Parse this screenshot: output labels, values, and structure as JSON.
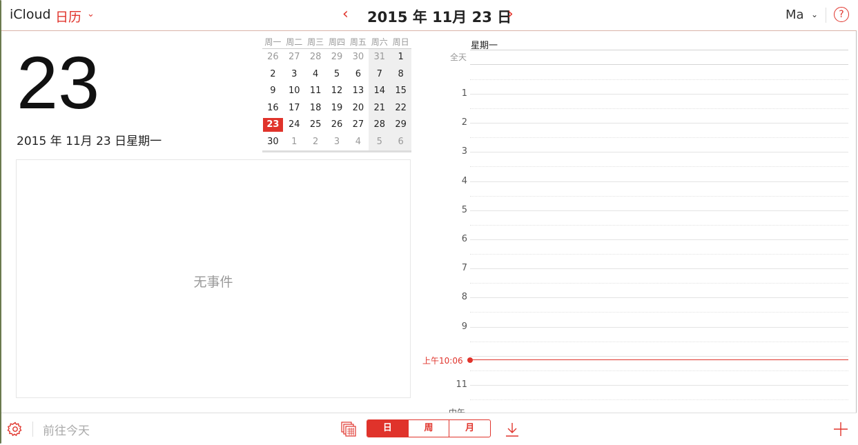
{
  "header": {
    "app_name": "iCloud",
    "app_section": "日历",
    "title": "2015 年 11月 23 日",
    "user": "Ma",
    "help": "?"
  },
  "day_panel": {
    "big_day": "23",
    "full_date": "2015 年 11月 23 日星期一",
    "no_events": "无事件"
  },
  "mini_calendar": {
    "weekdays": [
      "周一",
      "周二",
      "周三",
      "周四",
      "周五",
      "周六",
      "周日"
    ],
    "weeks": [
      [
        "26",
        "27",
        "28",
        "29",
        "30",
        "31",
        "1"
      ],
      [
        "2",
        "3",
        "4",
        "5",
        "6",
        "7",
        "8"
      ],
      [
        "9",
        "10",
        "11",
        "12",
        "13",
        "14",
        "15"
      ],
      [
        "16",
        "17",
        "18",
        "19",
        "20",
        "21",
        "22"
      ],
      [
        "23",
        "24",
        "25",
        "26",
        "27",
        "28",
        "29"
      ],
      [
        "30",
        "1",
        "2",
        "3",
        "4",
        "5",
        "6"
      ]
    ],
    "today": "23"
  },
  "day_view": {
    "weekday": "星期一",
    "all_day": "全天",
    "hours": [
      "1",
      "2",
      "3",
      "4",
      "5",
      "6",
      "7",
      "8",
      "9",
      "11"
    ],
    "now_label": "上午10:06",
    "clipped_label": "中午"
  },
  "footer": {
    "go_today": "前往今天",
    "view_tabs": [
      "日",
      "周",
      "月"
    ],
    "active_tab": "日"
  },
  "colors": {
    "accent": "#e0332b"
  }
}
